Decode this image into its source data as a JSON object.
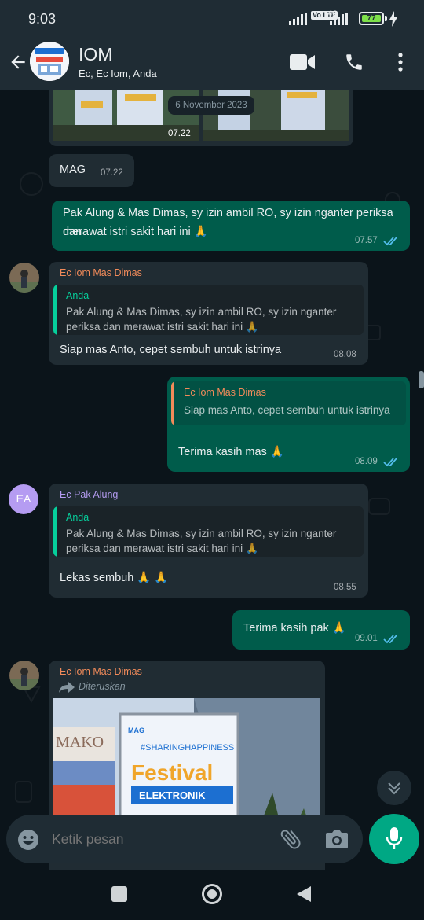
{
  "status_bar": {
    "time": "9:03",
    "volte": "Vo LTE",
    "network": "4G",
    "battery": "77"
  },
  "header": {
    "title": "IOM",
    "subtitle": "Ec, Ec Iom, Anda"
  },
  "date_chip": "6 November 2023",
  "messages": {
    "m0": {
      "time": "07.22"
    },
    "m1": {
      "text": "MAG",
      "time": "07.22"
    },
    "m2": {
      "line1": "Pak Alung & Mas Dimas, sy izin ambil RO, sy izin nganter periksa dan",
      "line2": "merawat istri sakit hari ini 🙏",
      "time": "07.57"
    },
    "m3": {
      "sender": "Ec Iom Mas Dimas",
      "quote_name": "Anda",
      "quote_line1": "Pak Alung & Mas Dimas, sy izin ambil RO, sy izin nganter",
      "quote_line2": "periksa dan merawat istri sakit hari ini 🙏",
      "text": "Siap mas Anto, cepet sembuh untuk istrinya",
      "time": "08.08"
    },
    "m4": {
      "quote_name": "Ec Iom Mas Dimas",
      "quote_text": "Siap mas Anto, cepet sembuh untuk istrinya",
      "text": "Terima kasih mas 🙏",
      "time": "08.09"
    },
    "m5": {
      "avatar_initials": "EA",
      "sender": "Ec Pak Alung",
      "quote_name": "Anda",
      "quote_line1": "Pak Alung & Mas Dimas, sy izin ambil RO, sy izin nganter",
      "quote_line2": "periksa dan merawat istri sakit hari ini 🙏",
      "text": "Lekas sembuh 🙏 🙏",
      "time": "08.55"
    },
    "m6": {
      "text": "Terima kasih pak 🙏",
      "time": "09.01"
    },
    "m7": {
      "sender": "Ec Iom Mas Dimas",
      "forwarded": "Diteruskan"
    }
  },
  "composer": {
    "placeholder": "Ketik pesan"
  },
  "colors": {
    "header_bg": "#1f2c34",
    "chat_bg": "#0b141a",
    "incoming": "#202c33",
    "outgoing": "#005c4b",
    "accent": "#00a884",
    "read_ticks": "#53bdeb",
    "sender_orange": "#f28b5a",
    "sender_purple": "#b59cf2"
  },
  "icons": [
    "back-arrow-icon",
    "video-call-icon",
    "phone-call-icon",
    "more-vert-icon",
    "read-ticks-icon",
    "forward-icon",
    "emoji-icon",
    "attach-icon",
    "camera-icon",
    "mic-icon",
    "scroll-down-icon",
    "recents-icon",
    "home-icon",
    "back-nav-icon"
  ]
}
